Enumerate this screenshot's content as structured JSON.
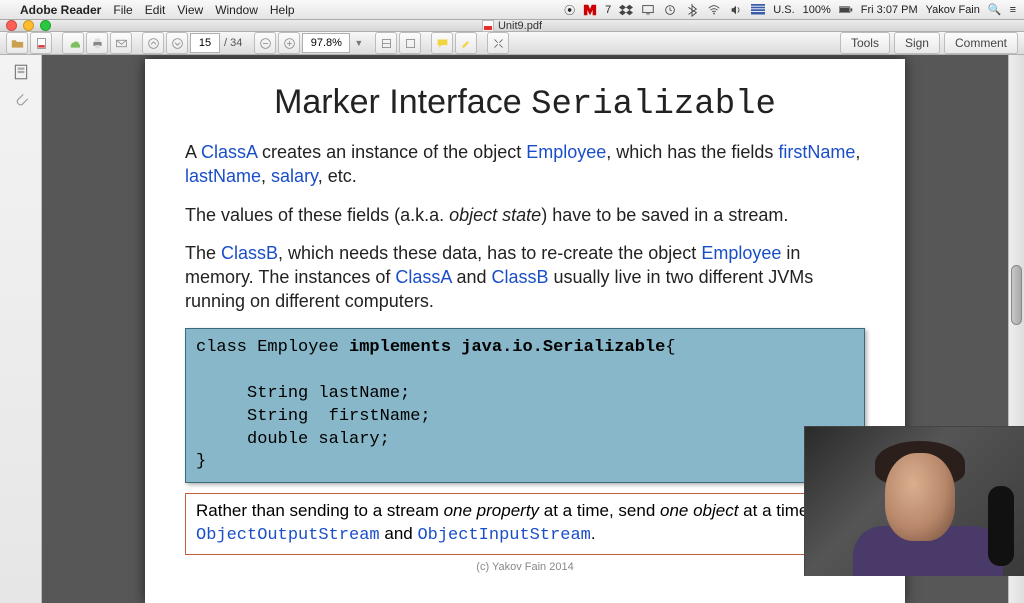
{
  "menubar": {
    "app": "Adobe Reader",
    "items": [
      "File",
      "Edit",
      "View",
      "Window",
      "Help"
    ],
    "right": {
      "recording": "⏺",
      "battery": "100%",
      "locale": "U.S.",
      "time": "Fri 3:07 PM",
      "user": "Yakov Fain"
    }
  },
  "window": {
    "title": "Unit9.pdf"
  },
  "toolbar": {
    "page_current": "15",
    "page_total": "/  34",
    "zoom": "97.8%",
    "right": [
      "Tools",
      "Sign",
      "Comment"
    ]
  },
  "doc": {
    "title_plain": "Marker Interface ",
    "title_mono": "Serializable",
    "p1_a": "A ",
    "p1_classA": "ClassA",
    "p1_b": " creates an instance of the object ",
    "p1_emp": "Employee",
    "p1_c": ", which has the fields ",
    "p1_fn": "firstName",
    "p1_comma1": ", ",
    "p1_ln": "lastName",
    "p1_comma2": ", ",
    "p1_sal": "salary",
    "p1_d": ", etc.",
    "p2_a": "The values of these fields (a.k.a. ",
    "p2_i": "object state",
    "p2_b": ") have to be saved in a stream.",
    "p3_a": "The ",
    "p3_classB": "ClassB",
    "p3_b": ", which needs these data, has to re-create the object ",
    "p3_emp": "Employee",
    "p3_c": " in memory. The instances of ",
    "p3_classA2": "ClassA",
    "p3_and": " and ",
    "p3_classB2": "ClassB",
    "p3_d": " usually live in two different JVMs running on different computers.",
    "code": "class Employee implements java.io.Serializable{\n\n     String lastName;\n     String  firstName;\n     double salary;\n}",
    "note_a": "Rather than sending to a stream ",
    "note_i1": "one property",
    "note_b": " at a time, send ",
    "note_i2": "one object",
    "note_c": " at a time using ",
    "note_m1": "ObjectOutputStream",
    "note_and": " and ",
    "note_m2": "ObjectInputStream",
    "note_d": ".",
    "footer": "(c) Yakov Fain  2014"
  }
}
